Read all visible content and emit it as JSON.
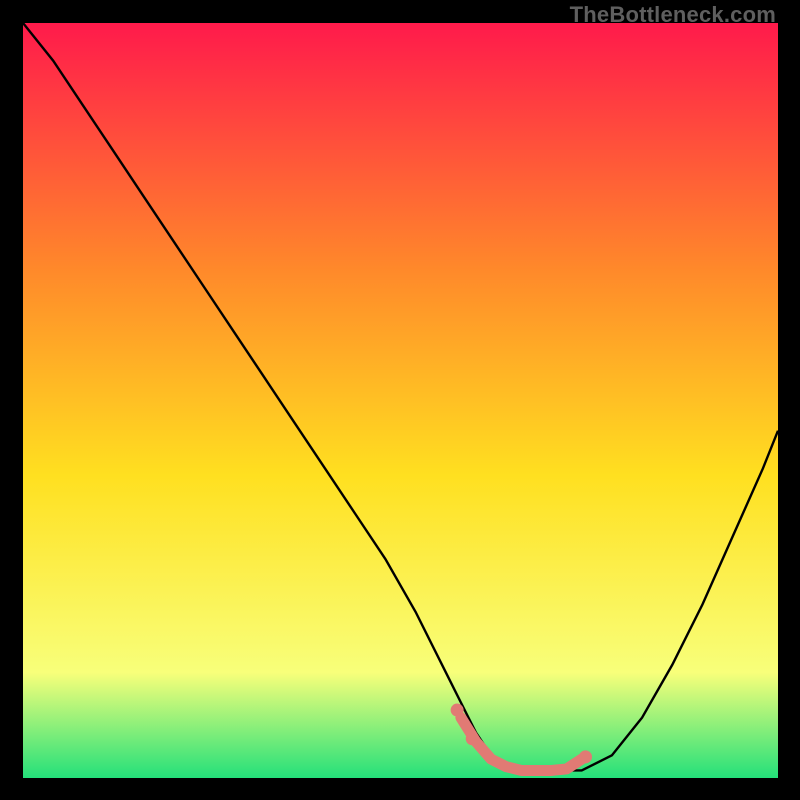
{
  "watermark": "TheBottleneck.com",
  "colors": {
    "gradient_top": "#ff1a4b",
    "gradient_mid1": "#ff8a2a",
    "gradient_mid2": "#ffe020",
    "gradient_mid3": "#f8ff7a",
    "gradient_bottom": "#24e07a",
    "curve": "#000000",
    "dash": "#e17a74",
    "frame": "#000000"
  },
  "chart_data": {
    "type": "line",
    "title": "",
    "xlabel": "",
    "ylabel": "",
    "xlim": [
      0,
      100
    ],
    "ylim": [
      0,
      100
    ],
    "series": [
      {
        "name": "bottleneck-curve",
        "x": [
          0,
          4,
          8,
          12,
          16,
          20,
          24,
          28,
          32,
          36,
          40,
          44,
          48,
          52,
          54,
          56,
          58,
          60,
          62,
          64,
          66,
          70,
          74,
          78,
          82,
          86,
          90,
          94,
          98,
          100
        ],
        "y": [
          100,
          95,
          89,
          83,
          77,
          71,
          65,
          59,
          53,
          47,
          41,
          35,
          29,
          22,
          18,
          14,
          10,
          6,
          3,
          1.5,
          1,
          1,
          1,
          3,
          8,
          15,
          23,
          32,
          41,
          46
        ]
      }
    ],
    "highlight_segment": {
      "name": "optimal-zone",
      "x": [
        58,
        60,
        62,
        64,
        66,
        70,
        72,
        74
      ],
      "y": [
        8,
        4.8,
        2.5,
        1.5,
        1,
        1,
        1.2,
        2.5
      ]
    },
    "highlight_dots": {
      "name": "optimal-markers",
      "x": [
        57.5,
        59.5,
        74.5
      ],
      "y": [
        9,
        5.2,
        2.8
      ]
    }
  }
}
